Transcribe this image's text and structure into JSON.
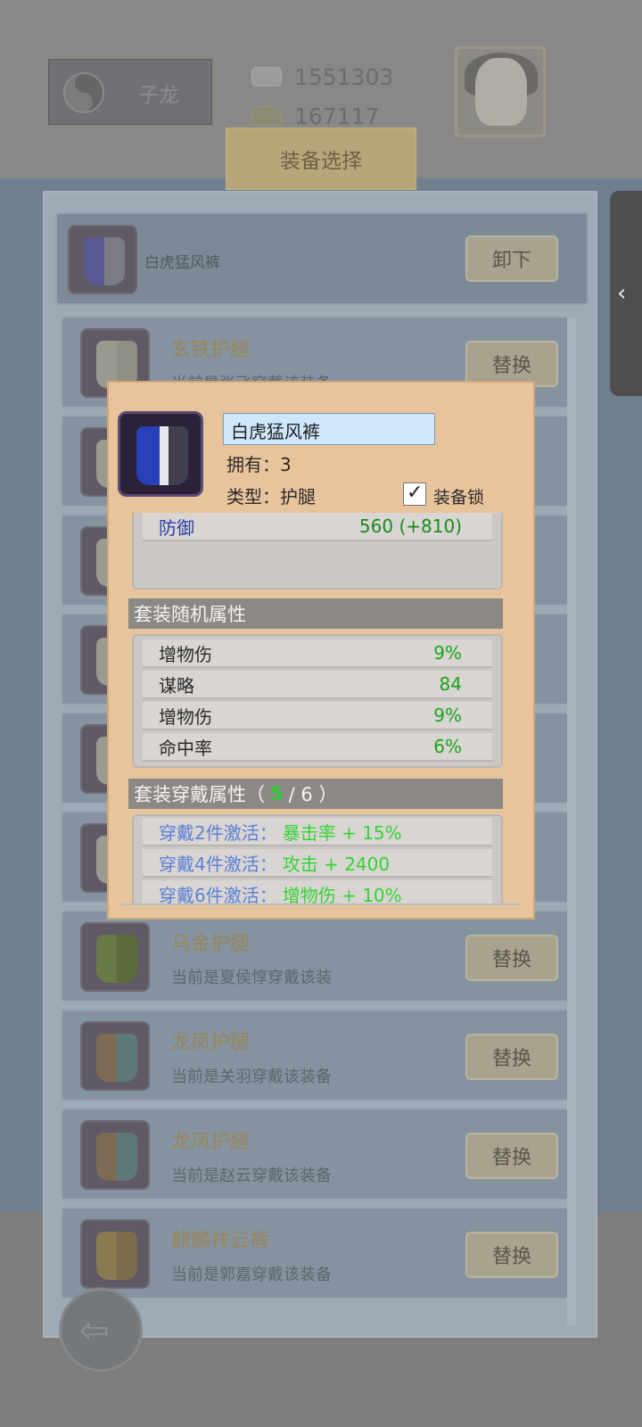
{
  "header": {
    "player_name": "子龙",
    "silver": "1551303",
    "gold": "167117",
    "tab_title": "装备选择"
  },
  "equipped": {
    "name": "白虎猛风裤",
    "unequip_label": "卸下"
  },
  "list": [
    {
      "name": "玄铁护腿",
      "desc": "当前是张飞穿戴该装备",
      "button": "替换",
      "icon": "leg-armor-white-icon"
    },
    {
      "name": "",
      "desc": "",
      "button": "",
      "icon": "leg-armor-white-icon"
    },
    {
      "name": "",
      "desc": "",
      "button": "",
      "icon": "leg-armor-white-icon"
    },
    {
      "name": "",
      "desc": "",
      "button": "",
      "icon": "leg-armor-white-icon"
    },
    {
      "name": "",
      "desc": "",
      "button": "",
      "icon": "leg-armor-white-icon"
    },
    {
      "name": "",
      "desc": "",
      "button": "",
      "icon": "leg-armor-white-icon"
    },
    {
      "name": "乌金护腿",
      "desc": "当前是夏侯惇穿戴该装",
      "button": "替换",
      "icon": "leg-armor-green-icon"
    },
    {
      "name": "龙凤护腿",
      "desc": "当前是关羽穿戴该装备",
      "button": "替换",
      "icon": "leg-armor-dragon-icon"
    },
    {
      "name": "龙凤护腿",
      "desc": "当前是赵云穿戴该装备",
      "button": "替换",
      "icon": "leg-armor-dragon-icon"
    },
    {
      "name": "麒麟祥云裤",
      "desc": "当前是郭嘉穿戴该装备",
      "button": "替换",
      "icon": "leg-armor-qilin-icon"
    }
  ],
  "popup": {
    "item_name": "白虎猛风裤",
    "owned_label": "拥有：3",
    "type_label": "类型：护腿",
    "lock_label": "装备锁",
    "lock_checked": true,
    "base_stat": {
      "name": "防御",
      "value": "560 (+810)"
    },
    "random_title": "套装随机属性",
    "random_stats": [
      {
        "name": "增物伤",
        "value": "9%"
      },
      {
        "name": "谋略",
        "value": "84"
      },
      {
        "name": "增物伤",
        "value": "9%"
      },
      {
        "name": "命中率",
        "value": "6%"
      }
    ],
    "set_title": "套装穿戴属性（",
    "set_count": "5",
    "set_total": "/ 6 ）",
    "set_bonuses": [
      {
        "cond": "穿戴2件激活：",
        "effect": "暴击率 + 15%"
      },
      {
        "cond": "穿戴4件激活：",
        "effect": "攻击 + 2400"
      },
      {
        "cond": "穿戴6件激活：",
        "effect": "增物伤 + 10%"
      }
    ]
  },
  "side_handle_glyph": "‹",
  "back_glyph": "⇦"
}
